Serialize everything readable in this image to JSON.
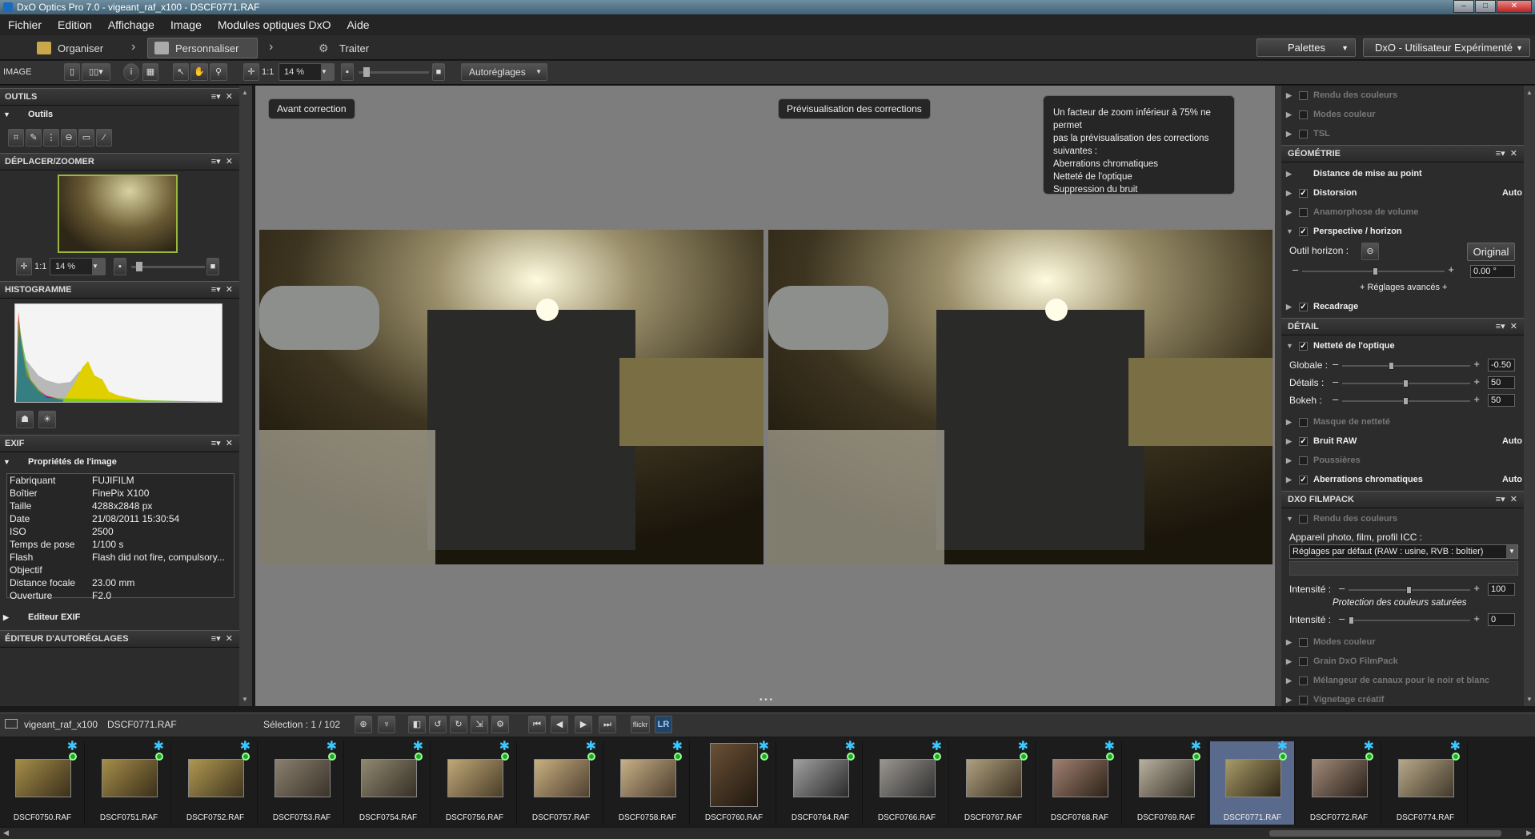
{
  "window": {
    "title": "DxO Optics Pro 7.0 - vigeant_raf_x100 - DSCF0771.RAF"
  },
  "menu": [
    "Fichier",
    "Edition",
    "Affichage",
    "Image",
    "Modules optiques DxO",
    "Aide"
  ],
  "nav": {
    "organiser": "Organiser",
    "personnaliser": "Personnaliser",
    "traiter": "Traiter",
    "palettes": "Palettes",
    "workspace": "DxO - Utilisateur Expérimenté"
  },
  "toolbar": {
    "image_label": "IMAGE",
    "one_to_one": "1:1",
    "zoom": "14 %",
    "autoreglages": "Autoréglages"
  },
  "left": {
    "outils": {
      "title": "OUTILS",
      "sub": "Outils"
    },
    "zoomer": {
      "title": "DÉPLACER/ZOOMER",
      "one_to_one": "1:1",
      "zoom": "14 %"
    },
    "histogram": {
      "title": "HISTOGRAMME"
    },
    "exif": {
      "title": "EXIF",
      "sub": "Propriétés de l'image",
      "rows": [
        {
          "k": "Fabriquant",
          "v": "FUJIFILM"
        },
        {
          "k": "Boîtier",
          "v": "FinePix X100"
        },
        {
          "k": "Taille",
          "v": "4288x2848 px"
        },
        {
          "k": "Date",
          "v": "21/08/2011 15:30:54"
        },
        {
          "k": "ISO",
          "v": "2500"
        },
        {
          "k": "Temps de pose",
          "v": "1/100 s"
        },
        {
          "k": "Flash",
          "v": "Flash did not fire, compulsory..."
        },
        {
          "k": "Objectif",
          "v": ""
        },
        {
          "k": "Distance focale",
          "v": "23.00 mm"
        },
        {
          "k": "Ouverture",
          "v": "F2.0"
        }
      ],
      "editor": "Editeur EXIF"
    },
    "autoreglages_editor": {
      "title": "ÉDITEUR D'AUTORÉGLAGES"
    }
  },
  "center": {
    "before_label": "Avant correction",
    "preview_label": "Prévisualisation des corrections",
    "note_lines": [
      "Un facteur de zoom inférieur à 75% ne permet",
      "pas la prévisualisation des corrections",
      "suivantes :",
      "Aberrations chromatiques",
      "Netteté de l'optique",
      "Suppression du bruit"
    ]
  },
  "right": {
    "top_items": [
      "Rendu des couleurs",
      "Modes couleur",
      "TSL"
    ],
    "geometrie": {
      "title": "GÉOMÉTRIE",
      "distance": "Distance de mise au point",
      "distorsion": "Distorsion",
      "distorsion_value": "Auto",
      "anamorphose": "Anamorphose de volume",
      "perspective": "Perspective / horizon",
      "outil_horizon": "Outil horizon :",
      "original": "Original",
      "angle": "0.00 °",
      "avances": "+ Réglages avancés +",
      "recadrage": "Recadrage"
    },
    "detail": {
      "title": "DÉTAIL",
      "nettete": "Netteté de l'optique",
      "globale_label": "Globale :",
      "globale": "-0.50",
      "details_label": "Détails :",
      "details": "50",
      "bokeh_label": "Bokeh :",
      "bokeh": "50",
      "masque": "Masque de netteté",
      "bruit": "Bruit RAW",
      "bruit_value": "Auto",
      "poussieres": "Poussières",
      "aberrations": "Aberrations chromatiques",
      "aberrations_value": "Auto"
    },
    "filmpack": {
      "title": "DXO FILMPACK",
      "rendu": "Rendu des couleurs",
      "appareil": "Appareil photo, film, profil ICC :",
      "select": "Réglages par défaut (RAW : usine, RVB : boîtier)",
      "intensite_label": "Intensité :",
      "intensite": "100",
      "protection": "Protection des couleurs saturées",
      "intensite2_label": "Intensité :",
      "intensite2": "0",
      "modes": "Modes couleur",
      "grain": "Grain DxO FilmPack",
      "melangeur": "Mélangeur de canaux pour le noir et blanc",
      "vignetage": "Vignetage créatif"
    }
  },
  "strip": {
    "folder": "vigeant_raf_x100",
    "file": "DSCF0771.RAF",
    "selection": "Sélection : 1 / 102",
    "flickr": "flickr",
    "lr": "LR",
    "thumbs": [
      "DSCF0750.RAF",
      "DSCF0751.RAF",
      "DSCF0752.RAF",
      "DSCF0753.RAF",
      "DSCF0754.RAF",
      "DSCF0756.RAF",
      "DSCF0757.RAF",
      "DSCF0758.RAF",
      "DSCF0760.RAF",
      "DSCF0764.RAF",
      "DSCF0766.RAF",
      "DSCF0767.RAF",
      "DSCF0768.RAF",
      "DSCF0769.RAF",
      "DSCF0771.RAF",
      "DSCF0772.RAF",
      "DSCF0774.RAF"
    ],
    "selected_index": 14
  },
  "colors": {
    "selection": "#5a6a8c",
    "star": "#3cc8ff",
    "status_ok": "#22aa22"
  }
}
